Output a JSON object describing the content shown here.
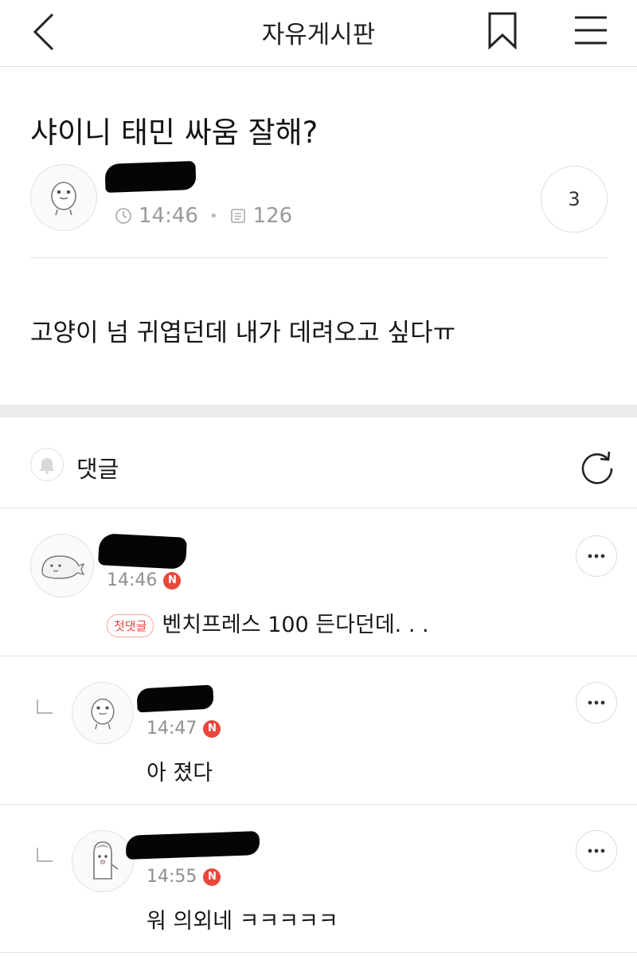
{
  "header": {
    "title": "자유게시판",
    "back_icon": "chevron-left-icon",
    "bookmark_icon": "bookmark-icon",
    "menu_icon": "hamburger-menu-icon"
  },
  "post": {
    "title": "샤이니 태민 싸움 잘해?",
    "time": "14:46",
    "views": "126",
    "comment_count": "3",
    "body": "고양이 넘 귀엽던데 내가 데려오고 싶다ㅠ"
  },
  "comments_section": {
    "label": "댓글"
  },
  "comments": [
    {
      "time": "14:46",
      "new_badge": "N",
      "first_badge": "첫댓글",
      "text": "벤치프레스 100 든다던데. . ."
    },
    {
      "time": "14:47",
      "new_badge": "N",
      "text": "아 졌다"
    },
    {
      "time": "14:55",
      "new_badge": "N",
      "text": "워 의외네 ㅋㅋㅋㅋㅋ"
    }
  ],
  "colors": {
    "accent_red": "#e8473b",
    "divider": "#e3e3e3",
    "band": "#ececee",
    "meta_gray": "#9a9a9a"
  }
}
